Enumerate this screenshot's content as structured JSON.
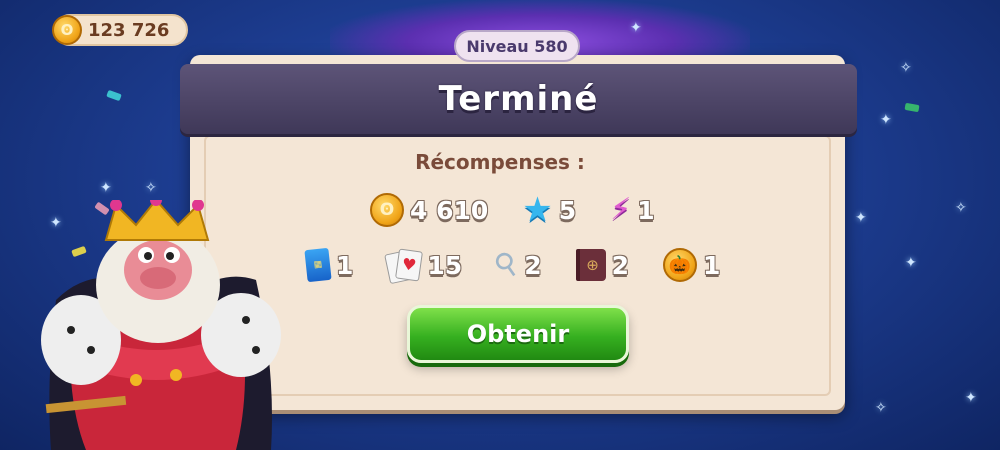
{
  "coins": {
    "value": "123 726"
  },
  "level": {
    "label": "Niveau 580"
  },
  "dialog": {
    "title": "Terminé",
    "rewards_title": "Récompenses :",
    "rewards_row1": [
      {
        "icon": "gold-coin-icon",
        "count": "4 610"
      },
      {
        "icon": "blue-star-icon",
        "count": "5"
      },
      {
        "icon": "lightning-bolt-icon",
        "count": "1"
      }
    ],
    "rewards_row2": [
      {
        "icon": "card-pack-icon",
        "count": "1"
      },
      {
        "icon": "playing-cards-icon",
        "count": "15"
      },
      {
        "icon": "spoon-icon",
        "count": "2"
      },
      {
        "icon": "passport-book-icon",
        "count": "2"
      },
      {
        "icon": "pumpkin-coin-icon",
        "count": "1"
      }
    ],
    "claim_button": "Obtenir"
  },
  "colors": {
    "background": "#1d3d91",
    "panel": "#f4e6d6",
    "banner": "#4b4466",
    "button": "#36b020"
  }
}
